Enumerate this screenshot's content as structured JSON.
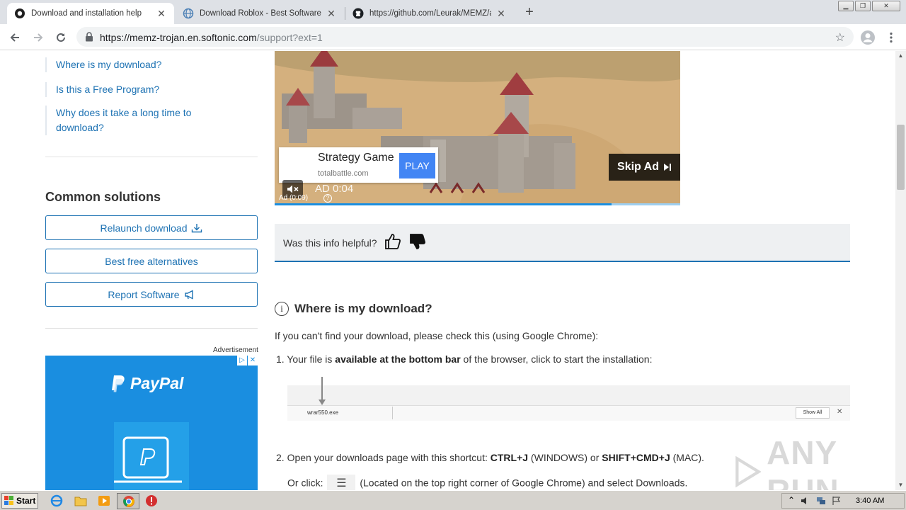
{
  "tabs": [
    {
      "title": "Download and installation help",
      "active": true
    },
    {
      "title": "Download Roblox - Best Software &",
      "active": false
    },
    {
      "title": "https://github.com/Leurak/MEMZ/ar",
      "active": false
    }
  ],
  "address": {
    "host": "https://memz-trojan.en.softonic.com",
    "path": "/support?ext=1"
  },
  "sidebar": {
    "links": [
      "Where is my download?",
      "Is this a Free Program?",
      "Why does it take a long time to download?"
    ],
    "solutions_heading": "Common solutions",
    "buttons": [
      "Relaunch download",
      "Best free alternatives",
      "Report Software"
    ],
    "advertisement_label": "Advertisement",
    "paypal_brand": "PayPal",
    "paypal_badges": [
      "▷",
      "✕"
    ]
  },
  "video_ad": {
    "game_title": "Strategy Game",
    "domain": "totalbattle.com",
    "play_label": "PLAY",
    "skip_label": "Skip Ad",
    "timer_label": "AD  0:04",
    "ad_count": "Ad (0:09)",
    "progress": 0.83
  },
  "feedback": {
    "question": "Was this info helpful?"
  },
  "article": {
    "heading": "Where is my download?",
    "intro": "If you can't find your download, please check this (using Google Chrome):",
    "step1_num": "1.",
    "step1_pre": "Your file is ",
    "step1_bold": "available at the bottom bar",
    "step1_post": " of the browser, click to start the installation:",
    "dlbar_file": "wrar550.exe",
    "dlbar_showall": "Show All",
    "step2_num": "2.",
    "step2_pre": "Open your downloads page with this shortcut: ",
    "step2_k1": "CTRL+J",
    "step2_mid": " (WINDOWS) or ",
    "step2_k2": "SHIFT+CMD+J",
    "step2_post": " (MAC).",
    "step2b_pre": "Or click:",
    "step2b_post": "(Located on the top right corner of Google Chrome) and select Downloads."
  },
  "watermark": "ANY RUN",
  "taskbar": {
    "start_label": "Start",
    "clock": "3:40 AM"
  },
  "colors": {
    "link": "#1d72b3",
    "tabstrip": "#dee1e6",
    "paypal": "#1a8ee0",
    "play": "#4285f4"
  }
}
